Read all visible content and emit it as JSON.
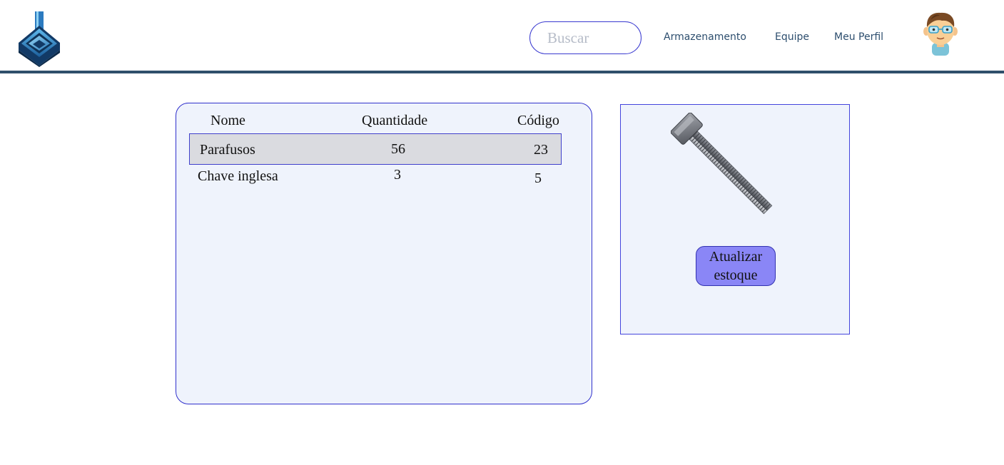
{
  "header": {
    "search": {
      "placeholder": "Buscar"
    },
    "nav": [
      {
        "label": "Armazenamento"
      },
      {
        "label": "Equipe"
      },
      {
        "label": "Meu Perfil"
      }
    ],
    "logo_icon": "flask-shield-logo",
    "avatar_icon": "scientist-avatar"
  },
  "inventory": {
    "columns": [
      "Nome",
      "Quantidade",
      "Código"
    ],
    "rows": [
      {
        "nome": "Parafusos",
        "quantidade": "56",
        "codigo": "23",
        "selected": true
      },
      {
        "nome": "Chave inglesa",
        "quantidade": "3",
        "codigo": "5",
        "selected": false
      }
    ]
  },
  "detail": {
    "image_icon": "bolt-icon",
    "update_button": {
      "line1": "Atualizar",
      "line2": "estoque"
    }
  },
  "colors": {
    "header_divider": "#2f4f6b",
    "panel_border": "#3030cc",
    "panel_background": "#eff3fc",
    "selected_row": "#dadbe0",
    "button_background": "#8a86f6",
    "nav_text": "#2d4e6e"
  }
}
